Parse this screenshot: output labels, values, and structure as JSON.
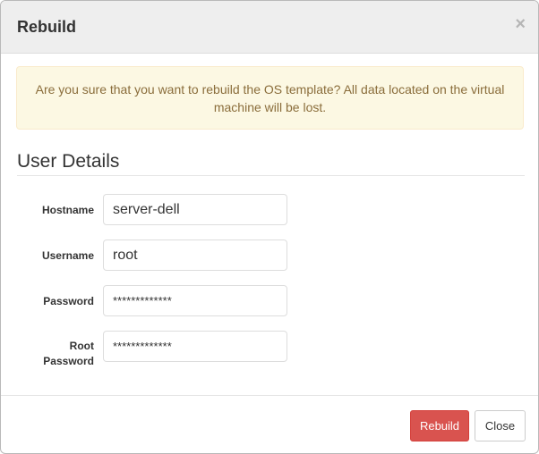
{
  "modal": {
    "title": "Rebuild",
    "close_symbol": "×",
    "close_icon": "close-icon"
  },
  "alert": {
    "message": "Are you sure that you want to rebuild the OS template? All data located on the virtual machine will be lost."
  },
  "section": {
    "title": "User Details"
  },
  "form": {
    "hostname": {
      "label": "Hostname",
      "value": "server-dell"
    },
    "username": {
      "label": "Username",
      "value": "root"
    },
    "password": {
      "label": "Password",
      "value": "*************"
    },
    "root_password": {
      "label_line1": "Root",
      "label_line2": "Password",
      "value": "*************"
    }
  },
  "footer": {
    "rebuild_label": "Rebuild",
    "close_label": "Close"
  },
  "colors": {
    "danger": "#d9534f",
    "alert_bg": "#fcf8e3",
    "alert_text": "#8a6d3b"
  }
}
